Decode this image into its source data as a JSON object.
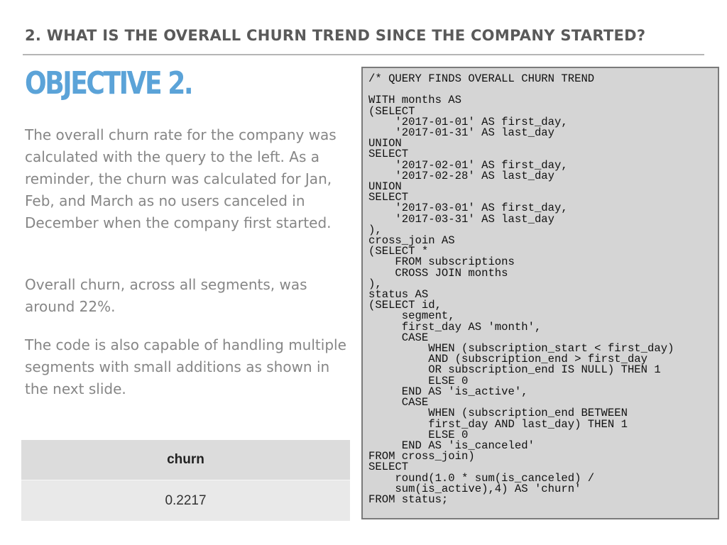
{
  "header": {
    "title": "2. WHAT IS THE OVERALL CHURN TREND SINCE THE COMPANY STARTED?"
  },
  "objective": {
    "heading": "OBJECTIVE 2."
  },
  "body": {
    "paragraph_1": "The overall churn rate for the company was calculated with the query to the left. As a reminder, the churn was calculated for Jan, Feb, and March as no users canceled in December when the company first started.",
    "paragraph_2": "Overall churn, across all segments, was around 22%.",
    "paragraph_3": "The code is also capable of handling multiple segments with small additions as shown in the next slide."
  },
  "result_table": {
    "header": "churn",
    "value": "0.2217"
  },
  "code": {
    "text": "/* QUERY FINDS OVERALL CHURN TREND\n\nWITH months AS\n(SELECT\n    '2017-01-01' AS first_day,\n    '2017-01-31' AS last_day\nUNION\nSELECT\n    '2017-02-01' AS first_day,\n    '2017-02-28' AS last_day\nUNION\nSELECT\n    '2017-03-01' AS first_day,\n    '2017-03-31' AS last_day\n),\ncross_join AS\n(SELECT *\n    FROM subscriptions\n    CROSS JOIN months\n),\nstatus AS\n(SELECT id,\n     segment,\n     first_day AS 'month',\n     CASE\n         WHEN (subscription_start < first_day)\n         AND (subscription_end > first_day\n         OR subscription_end IS NULL) THEN 1\n         ELSE 0\n     END AS 'is_active',\n     CASE\n         WHEN (subscription_end BETWEEN\n         first_day AND last_day) THEN 1\n         ELSE 0\n     END AS 'is_canceled'\nFROM cross_join)\nSELECT\n    round(1.0 * sum(is_canceled) /\n    sum(is_active),4) AS 'churn'\nFROM status;"
  },
  "colors": {
    "heading_accent": "#5ba3d8",
    "header_text": "#5a5a5a",
    "body_text": "#868686",
    "code_background": "#d5d5d5",
    "code_border": "#7a7a7a"
  }
}
